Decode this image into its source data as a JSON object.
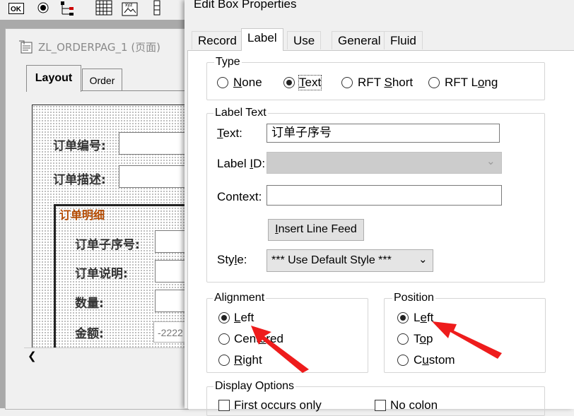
{
  "left_app": {
    "designer_title": "ZL_ORDERPAG_1 (页面)",
    "tabs": [
      "Layout",
      "Order"
    ],
    "fields": {
      "order_number": "订单编号:",
      "order_description": "订单描述:",
      "detail_group": "订单明细",
      "sub_sequence": "订单子序号:",
      "order_note": "订单说明:",
      "quantity": "数量:",
      "amount": "金额:",
      "amount_value": "-2222"
    }
  },
  "dialog": {
    "title": "Edit Box Properties",
    "tabs": [
      "Record",
      "Label",
      "Use",
      "General",
      "Fluid"
    ],
    "active_tab": "Label",
    "type": {
      "caption": "Type",
      "options": [
        "None",
        "Text",
        "RFT Short",
        "RFT Long"
      ],
      "selected": "Text"
    },
    "label_text": {
      "caption": "Label Text",
      "text_label": "Text:",
      "text_value": "订单子序号",
      "label_id_label": "Label ID:",
      "label_id_value": "",
      "context_label": "Context:",
      "context_value": "",
      "insert_button": "Insert Line Feed",
      "style_label": "Style:",
      "style_value": "*** Use Default Style ***"
    },
    "alignment": {
      "caption": "Alignment",
      "options": [
        "Left",
        "Centered",
        "Right"
      ],
      "selected": "Left"
    },
    "position": {
      "caption": "Position",
      "options": [
        "Left",
        "Top",
        "Custom"
      ],
      "selected": "Left"
    },
    "display_options": {
      "caption": "Display Options",
      "first_occurs_only": "First occurs only",
      "no_colon": "No colon"
    }
  },
  "colors": {
    "annotation_arrow": "#ee1c1c",
    "group_caption": "#b44a00",
    "workspace": "#a9a9a9"
  }
}
